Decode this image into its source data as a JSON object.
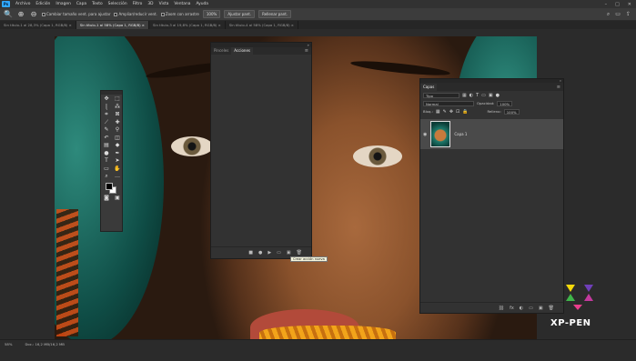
{
  "menubar": {
    "app_icon": "Ps",
    "items": [
      "Archivo",
      "Edición",
      "Imagen",
      "Capa",
      "Texto",
      "Selección",
      "Filtro",
      "3D",
      "Vista",
      "Ventana",
      "Ayuda"
    ],
    "window_controls": [
      "–",
      "□",
      "✕"
    ]
  },
  "options_bar": {
    "resize_windows": "Cambiar tamaño vent. para ajustar",
    "zoom_all": "Ampliar/reducir vent.",
    "scrubby_zoom": "Zoom con arrastre",
    "zoom_percent": "100%",
    "fit_screen": "Ajustar pant.",
    "fill_screen": "Rellenar pant."
  },
  "tabs": [
    {
      "label": "Sin título-1 al 28,3% (Capa 1, RGB/8) ×",
      "active": false
    },
    {
      "label": "Sin título-1 al 58% (Capa 1, RGB/8) ×",
      "active": true
    },
    {
      "label": "Sin título-3 al 19,8% (Capa 1, RGB/8) ×",
      "active": false
    },
    {
      "label": "Sin título-4 al 58% (Capa 1, RGB/8) ×",
      "active": false
    }
  ],
  "actions_panel": {
    "tabs": [
      "Pinceles",
      "Acciones"
    ],
    "active_tab": "Acciones",
    "footer_icons": [
      "■",
      "●",
      "▶",
      "▭",
      "▣",
      "🗑"
    ],
    "tooltip": "Crear acción nueva"
  },
  "layers_panel": {
    "tab": "Capas",
    "filter": "Tipo",
    "blend_mode": "Normal",
    "opacity_label": "Opacidad:",
    "opacity_value": "100%",
    "lock_label": "Bloq.:",
    "fill_label": "Relleno:",
    "fill_value": "100%",
    "layer_name": "Capa 1",
    "footer_icons": [
      "fx",
      "◐",
      "▭",
      "▣",
      "🗑"
    ]
  },
  "status": {
    "zoom": "58%",
    "doc": "Doc.: 16,2 MB/16,2 MB"
  },
  "watermark": {
    "brand": "XP-PEN",
    "colors": {
      "yellow": "#f5d90a",
      "green": "#3fb54a",
      "magenta": "#c33a9d",
      "purple": "#6f3fb8",
      "pink": "#e83e8c"
    }
  }
}
